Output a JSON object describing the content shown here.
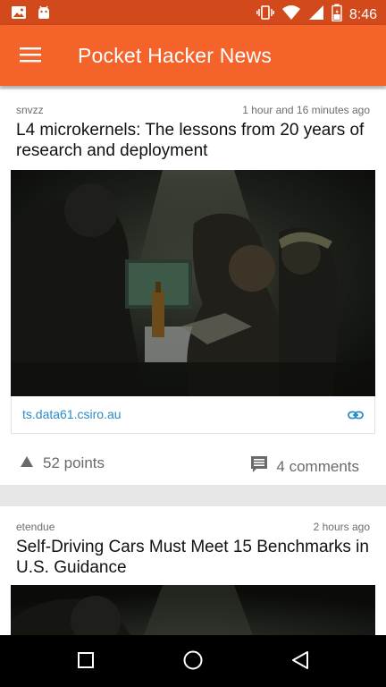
{
  "status_bar": {
    "time": "8:46",
    "left_icons": [
      "image-icon",
      "android-icon"
    ],
    "right_icons": [
      "vibrate-icon",
      "wifi-icon",
      "signal-icon",
      "battery-icon"
    ]
  },
  "app_bar": {
    "title": "Pocket Hacker News",
    "menu_icon": "hamburger-menu-icon",
    "color": "#f4642a"
  },
  "posts": [
    {
      "author": "snvzz",
      "time": "1 hour and 16 minutes ago",
      "title": "L4 microkernels: The lessons from 20 years of research and deployment",
      "domain": "ts.data61.csiro.au",
      "points": "52 points",
      "comments": "4 comments"
    },
    {
      "author": "etendue",
      "time": "2 hours ago",
      "title": "Self-Driving Cars Must Meet 15 Benchmarks in U.S. Guidance"
    }
  ],
  "nav_bar": {
    "buttons": [
      "recents-square-icon",
      "home-circle-icon",
      "back-triangle-icon"
    ]
  },
  "colors": {
    "status_bar": "#d24a1c",
    "app_bar": "#f4642a",
    "link": "#2a8cc7",
    "meta_text": "#6d6d6d"
  }
}
